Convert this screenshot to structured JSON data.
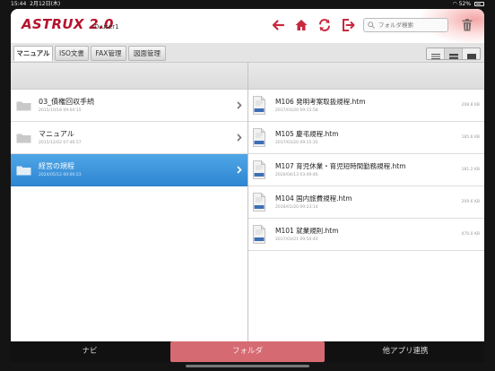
{
  "status": {
    "time": "15:44",
    "date": "2月12日(木)",
    "battery": "52%"
  },
  "header": {
    "logo": "ASTRUX 2.0",
    "user_id": "ID:user1",
    "search_placeholder": "フォルダ検索",
    "icons": [
      "back-arrow-icon",
      "home-icon",
      "sync-icon",
      "logout-icon",
      "trash-icon"
    ],
    "accent_color": "#b5142e"
  },
  "tabs": [
    {
      "label": "マニュアル",
      "active": true
    },
    {
      "label": "ISO文書",
      "active": false
    },
    {
      "label": "FAX管理",
      "active": false
    },
    {
      "label": "図面管理",
      "active": false
    }
  ],
  "view_modes": [
    "list-view-icon",
    "medium-view-icon",
    "large-view-icon"
  ],
  "folders": [
    {
      "name": "03_債権回収手続",
      "date": "2015/10/18 09:04:15",
      "selected": false
    },
    {
      "name": "マニュアル",
      "date": "2015/12/02 07:46:57",
      "selected": false
    },
    {
      "name": "経営の規程",
      "date": "2024/05/12 00:00:23",
      "selected": true
    }
  ],
  "files": [
    {
      "name": "M106 発明考案取扱規程.htm",
      "date": "2017/03/20 09:15:58",
      "size": "208.8 KB"
    },
    {
      "name": "M105 慶弔規程.htm",
      "date": "2017/03/20 09:15:35",
      "size": "185.6 KB"
    },
    {
      "name": "M107 育児休業・育児短時間勤務規程.htm",
      "date": "2020/04/13 03:49:46",
      "size": "181.2 KB"
    },
    {
      "name": "M104 国内旅費規程.htm",
      "date": "2016/01/20 09:23:14",
      "size": "209.6 KB"
    },
    {
      "name": "M101 就業規則.htm",
      "date": "2017/03/21 09:50:40",
      "size": "470.0 KB"
    }
  ],
  "bottom_tabs": [
    {
      "label": "ナビ",
      "active": false
    },
    {
      "label": "フォルダ",
      "active": true
    },
    {
      "label": "他アプリ連携",
      "active": false
    }
  ],
  "selected_color": "#3a93dc"
}
